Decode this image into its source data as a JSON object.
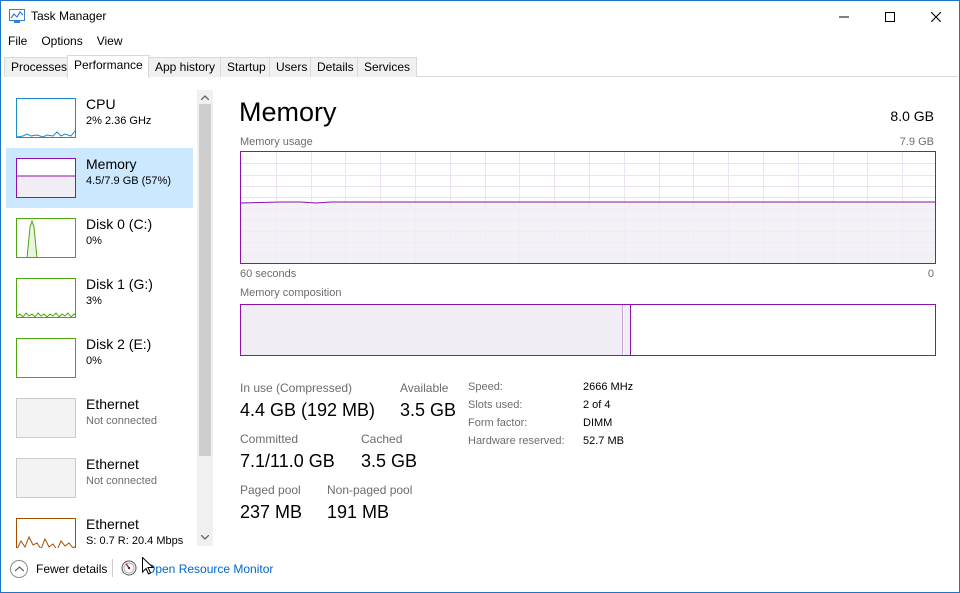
{
  "window": {
    "title": "Task Manager"
  },
  "menu": [
    "File",
    "Options",
    "View"
  ],
  "tabs": [
    "Processes",
    "Performance",
    "App history",
    "Startup",
    "Users",
    "Details",
    "Services"
  ],
  "active_tab": "Performance",
  "devices": [
    {
      "name": "CPU",
      "sub": "2% 2.36 GHz",
      "color": "#1a8cc8",
      "selected": false
    },
    {
      "name": "Memory",
      "sub": "4.5/7.9 GB (57%)",
      "color": "#8b12ae",
      "selected": true
    },
    {
      "name": "Disk 0 (C:)",
      "sub": "0%",
      "color": "#4da60c",
      "selected": false
    },
    {
      "name": "Disk 1 (G:)",
      "sub": "3%",
      "color": "#4da60c",
      "selected": false
    },
    {
      "name": "Disk 2 (E:)",
      "sub": "0%",
      "color": "#4da60c",
      "selected": false
    },
    {
      "name": "Ethernet",
      "sub": "Not connected",
      "color": "#cccccc",
      "selected": false
    },
    {
      "name": "Ethernet",
      "sub": "Not connected",
      "color": "#cccccc",
      "selected": false
    },
    {
      "name": "Ethernet",
      "sub": "S: 0.7 R: 20.4 Mbps",
      "color": "#a74f01",
      "selected": false
    }
  ],
  "detail": {
    "title": "Memory",
    "total": "8.0 GB",
    "usage_label": "Memory usage",
    "usage_max": "7.9 GB",
    "time_left": "60 seconds",
    "time_right": "0",
    "composition_label": "Memory composition",
    "in_use_fraction": 0.55,
    "stats": {
      "in_use_label": "In use (Compressed)",
      "in_use_value": "4.4 GB (192 MB)",
      "available_label": "Available",
      "available_value": "3.5 GB",
      "committed_label": "Committed",
      "committed_value": "7.1/11.0 GB",
      "cached_label": "Cached",
      "cached_value": "3.5 GB",
      "paged_label": "Paged pool",
      "paged_value": "237 MB",
      "nonpaged_label": "Non-paged pool",
      "nonpaged_value": "191 MB"
    },
    "specs": {
      "speed_label": "Speed:",
      "speed_value": "2666 MHz",
      "slots_label": "Slots used:",
      "slots_value": "2 of 4",
      "form_label": "Form factor:",
      "form_value": "DIMM",
      "reserved_label": "Hardware reserved:",
      "reserved_value": "52.7 MB"
    }
  },
  "footer": {
    "fewer": "Fewer details",
    "resmon": "Open Resource Monitor"
  },
  "colors": {
    "memory": "#8b12ae",
    "link": "#0066cc",
    "selected_bg": "#cce8ff"
  }
}
